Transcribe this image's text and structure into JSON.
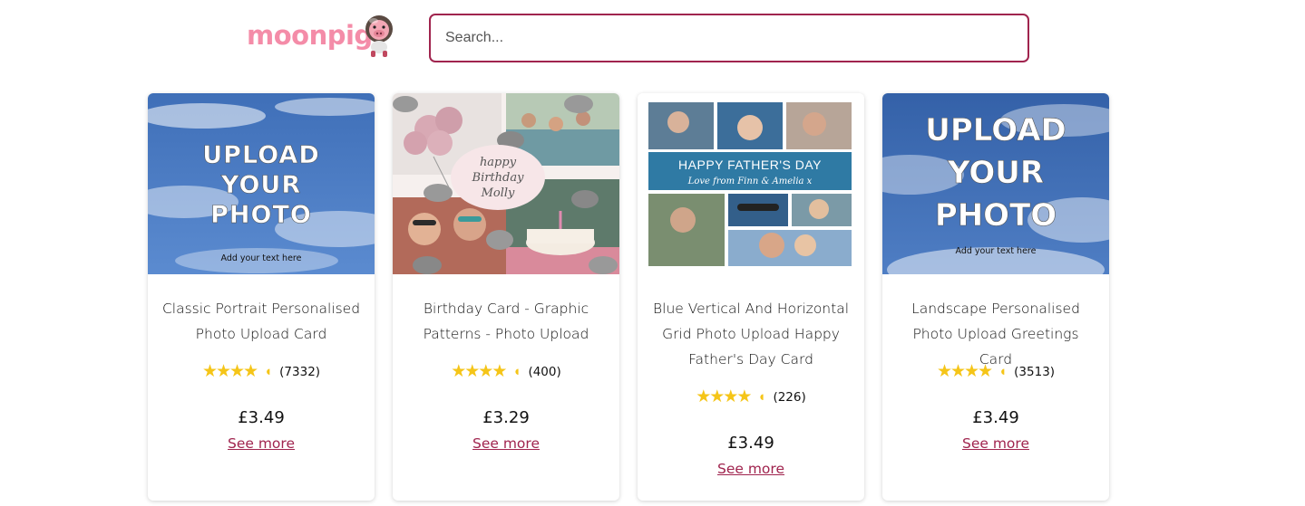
{
  "header": {
    "logo_text": "moonpig",
    "search_placeholder": "Search..."
  },
  "colors": {
    "brand_pink": "#f48ca8",
    "accent": "#a0244e",
    "star": "#f5c518"
  },
  "products": [
    {
      "title": "Classic Portrait Personalised Photo Upload Card",
      "image_text": [
        "UPLOAD",
        "YOUR",
        "PHOTO"
      ],
      "image_caption": "Add your text here",
      "rating": 4.5,
      "review_count": "(7332)",
      "price": "£3.49",
      "link_label": "See more"
    },
    {
      "title": "Birthday Card - Graphic Patterns - Photo Upload",
      "image_text": [
        "happy",
        "Birthday",
        "Molly"
      ],
      "rating": 4.5,
      "review_count": "(400)",
      "price": "£3.29",
      "link_label": "See more"
    },
    {
      "title": "Blue Vertical And Horizontal Grid Photo Upload Happy Father's Day Card",
      "image_text": [
        "HAPPY FATHER'S DAY",
        "Love from Finn & Amelia x"
      ],
      "rating": 4.5,
      "review_count": "(226)",
      "price": "£3.49",
      "link_label": "See more"
    },
    {
      "title": "Landscape Personalised Photo Upload Greetings Card",
      "image_text": [
        "UPLOAD",
        "YOUR",
        "PHOTO"
      ],
      "image_caption": "Add your text here",
      "rating": 4.5,
      "review_count": "(3513)",
      "price": "£3.49",
      "link_label": "See more"
    }
  ]
}
